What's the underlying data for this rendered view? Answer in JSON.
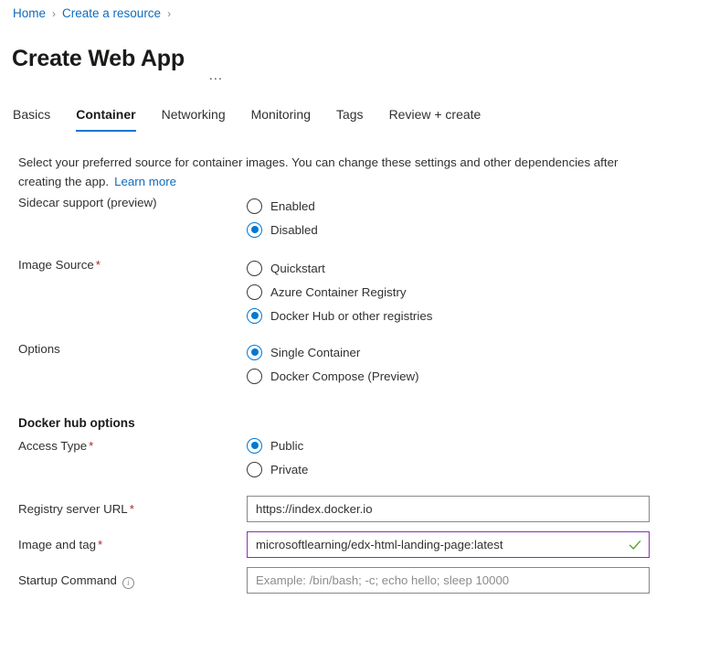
{
  "breadcrumb": {
    "items": [
      {
        "label": "Home"
      },
      {
        "label": "Create a resource"
      }
    ],
    "separator": "›"
  },
  "header": {
    "title": "Create Web App",
    "more_menu": "…"
  },
  "tabs": [
    {
      "label": "Basics",
      "active": false
    },
    {
      "label": "Container",
      "active": true
    },
    {
      "label": "Networking",
      "active": false
    },
    {
      "label": "Monitoring",
      "active": false
    },
    {
      "label": "Tags",
      "active": false
    },
    {
      "label": "Review + create",
      "active": false
    }
  ],
  "description": {
    "text": "Select your preferred source for container images. You can change these settings and other dependencies after creating the app.",
    "link_label": "Learn more"
  },
  "form": {
    "sidecar_support": {
      "label": "Sidecar support (preview)",
      "required": false,
      "options": [
        {
          "label": "Enabled",
          "selected": false
        },
        {
          "label": "Disabled",
          "selected": true
        }
      ]
    },
    "image_source": {
      "label": "Image Source",
      "required": true,
      "required_mark": "*",
      "options": [
        {
          "label": "Quickstart",
          "selected": false
        },
        {
          "label": "Azure Container Registry",
          "selected": false
        },
        {
          "label": "Docker Hub or other registries",
          "selected": true
        }
      ]
    },
    "options": {
      "label": "Options",
      "required": false,
      "options": [
        {
          "label": "Single Container",
          "selected": true
        },
        {
          "label": "Docker Compose (Preview)",
          "selected": false
        }
      ]
    },
    "docker_hub_heading": "Docker hub options",
    "access_type": {
      "label": "Access Type",
      "required": true,
      "required_mark": "*",
      "options": [
        {
          "label": "Public",
          "selected": true
        },
        {
          "label": "Private",
          "selected": false
        }
      ]
    },
    "registry_server_url": {
      "label": "Registry server URL",
      "required": true,
      "required_mark": "*",
      "value": "https://index.docker.io",
      "placeholder": "",
      "focused": false,
      "valid_check": false
    },
    "image_and_tag": {
      "label": "Image and tag",
      "required": true,
      "required_mark": "*",
      "value": "microsoftlearning/edx-html-landing-page:latest",
      "placeholder": "",
      "focused": true,
      "valid_check": true
    },
    "startup_command": {
      "label": "Startup Command",
      "required": false,
      "info_tooltip": "i",
      "value": "",
      "placeholder": "Example: /bin/bash; -c; echo hello; sleep 10000",
      "focused": false,
      "valid_check": false
    }
  },
  "colors": {
    "accent": "#0078d4",
    "link": "#0f6cbd",
    "required": "#a4262c",
    "focus_border": "#8d2fb0",
    "valid_check": "#5ca22e",
    "text": "#323130",
    "border": "#8a8886"
  }
}
